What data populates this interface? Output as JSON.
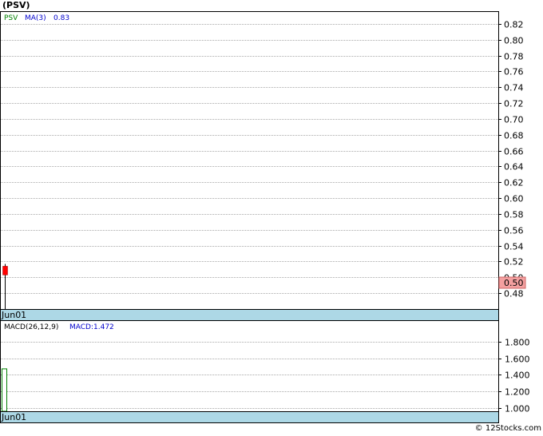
{
  "title": "(PSV)",
  "copyright": "© 12Stocks.com",
  "colors": {
    "background": "#ffffff",
    "grid": "#aaaaaa",
    "date_bar": "#add8e6",
    "candle": "#ff0000",
    "macd_bar": "#008000",
    "price_tag_bg": "#f4a0a0",
    "legend_symbol": "#008000",
    "legend_ma": "#0000cc"
  },
  "chart_data": [
    {
      "type": "candlestick",
      "legend": {
        "symbol": "PSV",
        "ma_label": "MA(3)",
        "ma_value": "0.83"
      },
      "ylim": [
        0.46,
        0.835
      ],
      "y_ticks": [
        0.48,
        0.5,
        0.52,
        0.54,
        0.56,
        0.58,
        0.6,
        0.62,
        0.64,
        0.66,
        0.68,
        0.7,
        0.72,
        0.74,
        0.76,
        0.78,
        0.8,
        0.82
      ],
      "y_tick_labels": [
        "0.48",
        "0.50",
        "0.52",
        "0.54",
        "0.56",
        "0.58",
        "0.60",
        "0.62",
        "0.64",
        "0.66",
        "0.68",
        "0.70",
        "0.72",
        "0.74",
        "0.76",
        "0.78",
        "0.80",
        "0.82"
      ],
      "current_price_label": "0.50",
      "current_price": 0.5,
      "x_label": "Jun01",
      "candles": [
        {
          "date": "Jun01",
          "open": 0.514,
          "high": 0.517,
          "low": 0.46,
          "close": 0.503
        }
      ]
    },
    {
      "type": "bar",
      "legend": {
        "label": "MACD(26,12,9)",
        "value_label": "MACD:1.472"
      },
      "ylim": [
        0.96,
        2.05
      ],
      "y_ticks": [
        1.0,
        1.2,
        1.4,
        1.6,
        1.8
      ],
      "y_tick_labels": [
        "1.000",
        "1.200",
        "1.400",
        "1.600",
        "1.800"
      ],
      "x_label": "Jun01",
      "values": [
        1.472
      ]
    }
  ]
}
